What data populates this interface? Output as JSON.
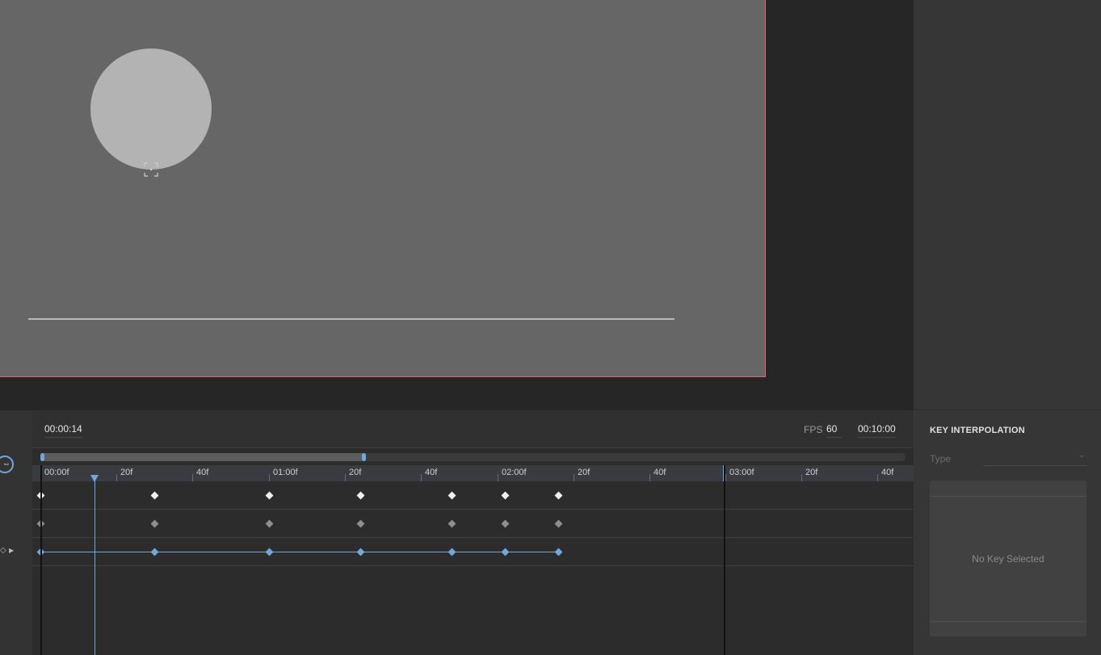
{
  "timeline": {
    "current_time": "00:00:14",
    "fps_label": "FPS",
    "fps_value": "60",
    "duration": "00:10:00",
    "ruler_labels": [
      "00:00f",
      "20f",
      "40f",
      "01:00f",
      "20f",
      "40f",
      "02:00f",
      "20f",
      "40f",
      "03:00f",
      "20f",
      "40f"
    ],
    "tracks": [
      {
        "style": "white",
        "keyframes": 7
      },
      {
        "style": "gray",
        "keyframes": 7
      },
      {
        "style": "blue",
        "keyframes": 7,
        "connected": true
      }
    ]
  },
  "key_interpolation": {
    "title": "KEY INTERPOLATION",
    "type_label": "Type",
    "type_value": "",
    "empty_message": "No Key Selected"
  },
  "colors": {
    "accent": "#6fa8dc",
    "canvas_border": "#e6657a",
    "canvas_bg": "#666666",
    "circle": "#b3b3b3"
  },
  "icons": {
    "zoom": "zoom-fit-icon",
    "anchor": "anchor-point-icon",
    "key": "keyframe-diamond-icon",
    "expand": "expand-arrow-icon"
  }
}
